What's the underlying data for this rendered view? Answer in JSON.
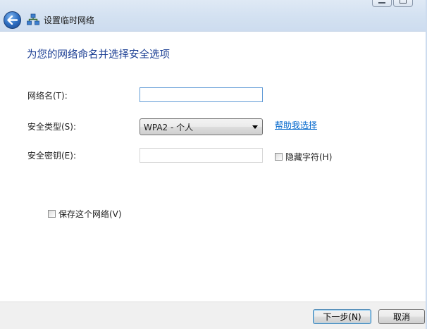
{
  "window": {
    "title": "设置临时网络"
  },
  "page": {
    "heading": "为您的网络命名并选择安全选项"
  },
  "form": {
    "network_name_label": "网络名(T):",
    "network_name_value": "",
    "security_type_label": "安全类型(S):",
    "security_type_selected": "WPA2 - 个人",
    "help_link": "帮助我选择",
    "security_key_label": "安全密钥(E):",
    "security_key_value": "",
    "hide_chars_label": "隐藏字符(H)",
    "save_network_label": "保存这个网络(V)"
  },
  "footer": {
    "next_label": "下一步(N)",
    "cancel_label": "取消"
  },
  "colors": {
    "heading": "#1c3f94",
    "link": "#0066cc",
    "titlebar": "#d3e1f1",
    "footer": "#f0f0f0"
  },
  "icons": [
    "back-arrow-icon",
    "network-icon",
    "minimize-icon",
    "maximize-icon",
    "dropdown-arrow-icon"
  ]
}
